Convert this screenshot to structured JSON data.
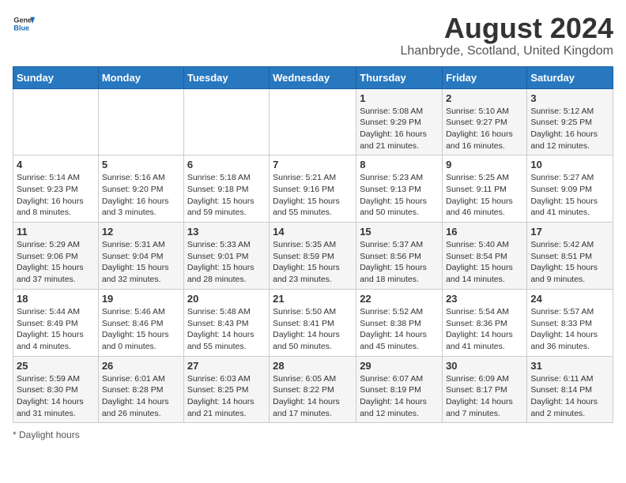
{
  "header": {
    "logo_general": "General",
    "logo_blue": "Blue",
    "month_year": "August 2024",
    "location": "Lhanbryde, Scotland, United Kingdom"
  },
  "weekdays": [
    "Sunday",
    "Monday",
    "Tuesday",
    "Wednesday",
    "Thursday",
    "Friday",
    "Saturday"
  ],
  "weeks": [
    [
      {
        "day": "",
        "info": ""
      },
      {
        "day": "",
        "info": ""
      },
      {
        "day": "",
        "info": ""
      },
      {
        "day": "",
        "info": ""
      },
      {
        "day": "1",
        "info": "Sunrise: 5:08 AM\nSunset: 9:29 PM\nDaylight: 16 hours and 21 minutes."
      },
      {
        "day": "2",
        "info": "Sunrise: 5:10 AM\nSunset: 9:27 PM\nDaylight: 16 hours and 16 minutes."
      },
      {
        "day": "3",
        "info": "Sunrise: 5:12 AM\nSunset: 9:25 PM\nDaylight: 16 hours and 12 minutes."
      }
    ],
    [
      {
        "day": "4",
        "info": "Sunrise: 5:14 AM\nSunset: 9:23 PM\nDaylight: 16 hours and 8 minutes."
      },
      {
        "day": "5",
        "info": "Sunrise: 5:16 AM\nSunset: 9:20 PM\nDaylight: 16 hours and 3 minutes."
      },
      {
        "day": "6",
        "info": "Sunrise: 5:18 AM\nSunset: 9:18 PM\nDaylight: 15 hours and 59 minutes."
      },
      {
        "day": "7",
        "info": "Sunrise: 5:21 AM\nSunset: 9:16 PM\nDaylight: 15 hours and 55 minutes."
      },
      {
        "day": "8",
        "info": "Sunrise: 5:23 AM\nSunset: 9:13 PM\nDaylight: 15 hours and 50 minutes."
      },
      {
        "day": "9",
        "info": "Sunrise: 5:25 AM\nSunset: 9:11 PM\nDaylight: 15 hours and 46 minutes."
      },
      {
        "day": "10",
        "info": "Sunrise: 5:27 AM\nSunset: 9:09 PM\nDaylight: 15 hours and 41 minutes."
      }
    ],
    [
      {
        "day": "11",
        "info": "Sunrise: 5:29 AM\nSunset: 9:06 PM\nDaylight: 15 hours and 37 minutes."
      },
      {
        "day": "12",
        "info": "Sunrise: 5:31 AM\nSunset: 9:04 PM\nDaylight: 15 hours and 32 minutes."
      },
      {
        "day": "13",
        "info": "Sunrise: 5:33 AM\nSunset: 9:01 PM\nDaylight: 15 hours and 28 minutes."
      },
      {
        "day": "14",
        "info": "Sunrise: 5:35 AM\nSunset: 8:59 PM\nDaylight: 15 hours and 23 minutes."
      },
      {
        "day": "15",
        "info": "Sunrise: 5:37 AM\nSunset: 8:56 PM\nDaylight: 15 hours and 18 minutes."
      },
      {
        "day": "16",
        "info": "Sunrise: 5:40 AM\nSunset: 8:54 PM\nDaylight: 15 hours and 14 minutes."
      },
      {
        "day": "17",
        "info": "Sunrise: 5:42 AM\nSunset: 8:51 PM\nDaylight: 15 hours and 9 minutes."
      }
    ],
    [
      {
        "day": "18",
        "info": "Sunrise: 5:44 AM\nSunset: 8:49 PM\nDaylight: 15 hours and 4 minutes."
      },
      {
        "day": "19",
        "info": "Sunrise: 5:46 AM\nSunset: 8:46 PM\nDaylight: 15 hours and 0 minutes."
      },
      {
        "day": "20",
        "info": "Sunrise: 5:48 AM\nSunset: 8:43 PM\nDaylight: 14 hours and 55 minutes."
      },
      {
        "day": "21",
        "info": "Sunrise: 5:50 AM\nSunset: 8:41 PM\nDaylight: 14 hours and 50 minutes."
      },
      {
        "day": "22",
        "info": "Sunrise: 5:52 AM\nSunset: 8:38 PM\nDaylight: 14 hours and 45 minutes."
      },
      {
        "day": "23",
        "info": "Sunrise: 5:54 AM\nSunset: 8:36 PM\nDaylight: 14 hours and 41 minutes."
      },
      {
        "day": "24",
        "info": "Sunrise: 5:57 AM\nSunset: 8:33 PM\nDaylight: 14 hours and 36 minutes."
      }
    ],
    [
      {
        "day": "25",
        "info": "Sunrise: 5:59 AM\nSunset: 8:30 PM\nDaylight: 14 hours and 31 minutes."
      },
      {
        "day": "26",
        "info": "Sunrise: 6:01 AM\nSunset: 8:28 PM\nDaylight: 14 hours and 26 minutes."
      },
      {
        "day": "27",
        "info": "Sunrise: 6:03 AM\nSunset: 8:25 PM\nDaylight: 14 hours and 21 minutes."
      },
      {
        "day": "28",
        "info": "Sunrise: 6:05 AM\nSunset: 8:22 PM\nDaylight: 14 hours and 17 minutes."
      },
      {
        "day": "29",
        "info": "Sunrise: 6:07 AM\nSunset: 8:19 PM\nDaylight: 14 hours and 12 minutes."
      },
      {
        "day": "30",
        "info": "Sunrise: 6:09 AM\nSunset: 8:17 PM\nDaylight: 14 hours and 7 minutes."
      },
      {
        "day": "31",
        "info": "Sunrise: 6:11 AM\nSunset: 8:14 PM\nDaylight: 14 hours and 2 minutes."
      }
    ]
  ],
  "footer": {
    "note": "Daylight hours"
  }
}
